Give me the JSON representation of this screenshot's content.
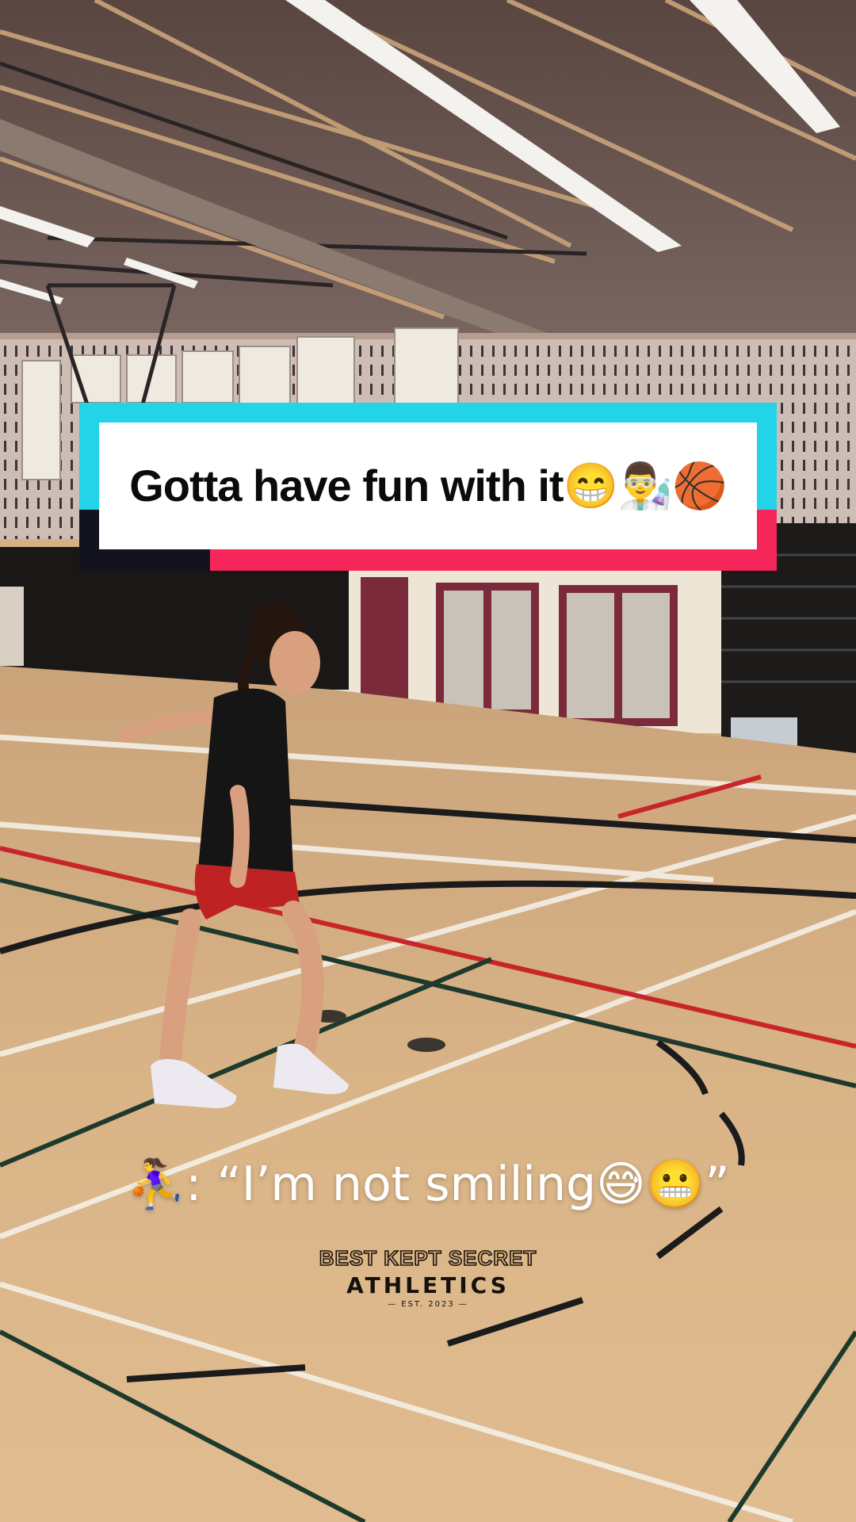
{
  "video": {
    "caption": "Gotta have fun with it😁👨‍🔬🏀",
    "subtitle": "⛹️‍♀️: “I’m not smiling😅😬”"
  },
  "logo": {
    "line1": "BEST KEPT SECRET",
    "line2": "ATHLETICS",
    "line3": "— EST. 2023 —"
  },
  "colors": {
    "caption_cyan": "#23d3e8",
    "caption_red": "#f5265a",
    "caption_white": "#ffffff"
  }
}
